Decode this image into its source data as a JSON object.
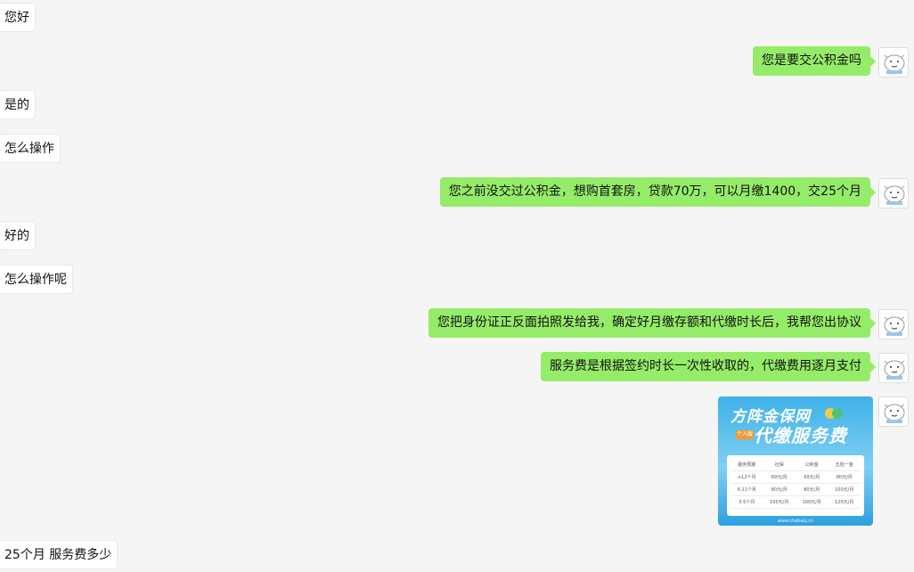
{
  "messages": [
    {
      "side": "left",
      "text": "您好"
    },
    {
      "side": "right",
      "text": "您是要交公积金吗"
    },
    {
      "side": "left",
      "text": "是的"
    },
    {
      "side": "left",
      "text": "怎么操作"
    },
    {
      "side": "right",
      "text": "您之前没交过公积金，想购首套房，贷款70万，可以月缴1400，交25个月"
    },
    {
      "side": "left",
      "text": "好的"
    },
    {
      "side": "left",
      "text": "怎么操作呢"
    },
    {
      "side": "right",
      "text": "您把身份证正反面拍照发给我，确定好月缴存额和代缴时长后，我帮您出协议"
    },
    {
      "side": "right",
      "text": "服务费是根据签约时长一次性收取的，代缴费用逐月支付"
    },
    {
      "side": "left",
      "text": "25个月 服务费多少"
    }
  ],
  "image_card": {
    "title_line1": "方阵金保网",
    "title_line2": "代缴服务费",
    "tag": "个人版",
    "table": {
      "headers": [
        "服务周期",
        "社保",
        "公积金",
        "五险一金"
      ],
      "rows": [
        [
          "≥12个月",
          "69元/月",
          "69元/月",
          "80元/月"
        ],
        [
          "6-11个月",
          "80元/月",
          "80元/月",
          "100元/月"
        ],
        [
          "3-5个月",
          "100元/月",
          "100元/月",
          "120元/月"
        ]
      ]
    },
    "footer": "www.shebaoj.cn"
  },
  "colors": {
    "self_bubble": "#95ec69",
    "other_bubble": "#ffffff",
    "background": "#f5f5f5"
  }
}
